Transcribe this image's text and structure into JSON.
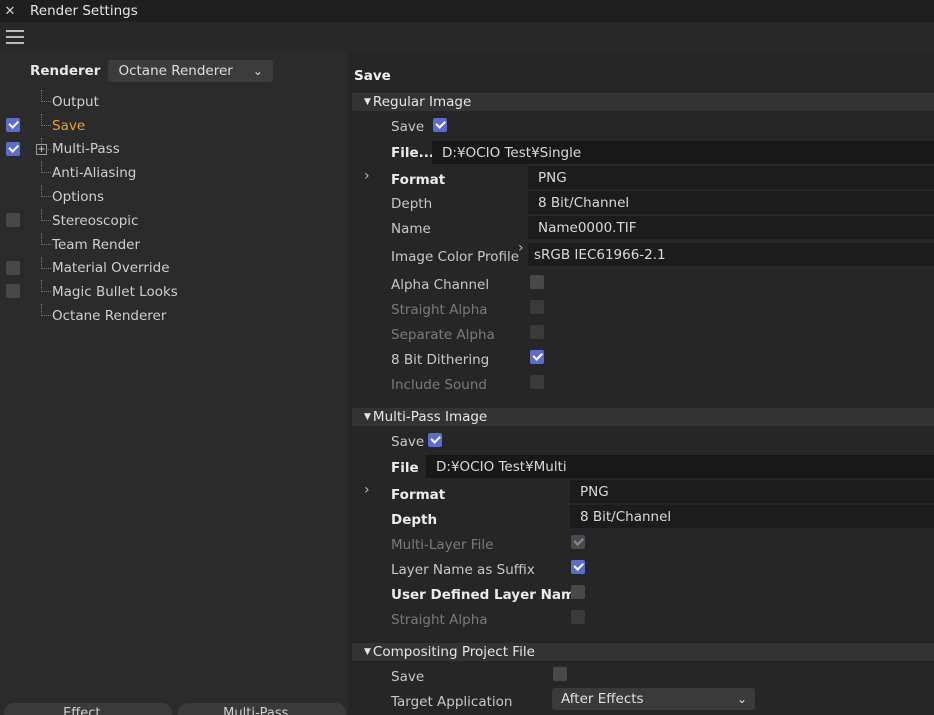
{
  "window": {
    "title": "Render Settings",
    "close_icon": "close-icon"
  },
  "left": {
    "renderer_label": "Renderer",
    "renderer_value": "Octane Renderer",
    "tree": [
      {
        "label": "Output",
        "checkbox": null,
        "active": false,
        "expander": false
      },
      {
        "label": "Save",
        "checkbox": true,
        "active": true,
        "expander": false
      },
      {
        "label": "Multi-Pass",
        "checkbox": true,
        "active": false,
        "expander": true
      },
      {
        "label": "Anti-Aliasing",
        "checkbox": null,
        "active": false,
        "expander": false
      },
      {
        "label": "Options",
        "checkbox": null,
        "active": false,
        "expander": false
      },
      {
        "label": "Stereoscopic",
        "checkbox": false,
        "active": false,
        "expander": false
      },
      {
        "label": "Team Render",
        "checkbox": null,
        "active": false,
        "expander": false
      },
      {
        "label": "Material Override",
        "checkbox": false,
        "active": false,
        "expander": false
      },
      {
        "label": "Magic Bullet Looks",
        "checkbox": false,
        "active": false,
        "expander": false
      },
      {
        "label": "Octane Renderer",
        "checkbox": null,
        "active": false,
        "expander": false
      }
    ],
    "bottom_tabs": [
      "Effect...",
      "Multi-Pass..."
    ]
  },
  "right": {
    "section_title": "Save",
    "regular": {
      "header": "Regular Image",
      "save_label": "Save",
      "file_label": "File...",
      "file_value": "D:¥OCIO Test¥Single",
      "format_label": "Format",
      "format_value": "PNG",
      "depth_label": "Depth",
      "depth_value": "8 Bit/Channel",
      "name_label": "Name",
      "name_value": "Name0000.TIF",
      "profile_label": "Image Color Profile",
      "profile_value": "sRGB IEC61966-2.1",
      "alpha_label": "Alpha Channel",
      "straight_alpha_label": "Straight Alpha",
      "separate_alpha_label": "Separate Alpha",
      "dithering_label": "8 Bit Dithering",
      "sound_label": "Include Sound"
    },
    "multipass": {
      "header": "Multi-Pass Image",
      "save_label": "Save",
      "file_label": "File",
      "file_value": "D:¥OCIO Test¥Multi",
      "format_label": "Format",
      "format_value": "PNG",
      "depth_label": "Depth",
      "depth_value": "8 Bit/Channel",
      "multilayer_label": "Multi-Layer File",
      "suffix_label": "Layer Name as Suffix",
      "user_layer_label": "User Defined Layer Name",
      "straight_alpha_label": "Straight Alpha"
    },
    "compositing": {
      "header": "Compositing Project File",
      "save_label": "Save",
      "target_label": "Target Application",
      "target_value": "After Effects"
    }
  },
  "colors": {
    "accent_check": "#5b6bd0",
    "active_item": "#f0a030"
  }
}
